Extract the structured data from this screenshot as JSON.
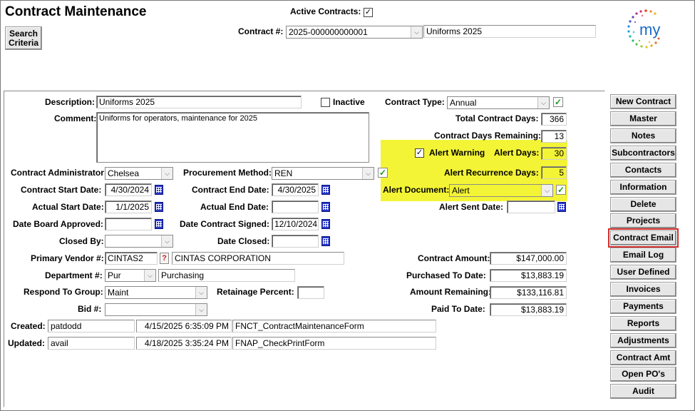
{
  "header": {
    "title": "Contract Maintenance",
    "search_button": "Search Criteria",
    "active_contracts_label": "Active Contracts:",
    "active_contracts_checked": true,
    "contract_no_label": "Contract #:",
    "contract_no_value": "2025-000000000001",
    "contract_name_value": "Uniforms 2025",
    "logo_text": "my"
  },
  "form": {
    "description_label": "Description:",
    "description_value": "Uniforms 2025",
    "inactive_label": "Inactive",
    "inactive_checked": false,
    "comment_label": "Comment:",
    "comment_value": "Uniforms for operators,  maintenance for 2025",
    "contract_type_label": "Contract Type:",
    "contract_type_value": "Annual",
    "total_days_label": "Total Contract Days:",
    "total_days_value": "366",
    "days_remaining_label": "Contract Days Remaining:",
    "days_remaining_value": "13",
    "alert_warning_label": "Alert Warning",
    "alert_warning_checked": true,
    "alert_days_label": "Alert Days:",
    "alert_days_value": "30",
    "alert_recurrence_label": "Alert Recurrence Days:",
    "alert_recurrence_value": "5",
    "alert_document_label": "Alert Document:",
    "alert_document_value": "Alert",
    "alert_sent_label": "Alert Sent Date:",
    "alert_sent_value": "",
    "admin_label": "Contract Administrator:",
    "admin_value": "Chelsea",
    "procurement_label": "Procurement Method:",
    "procurement_value": "REN",
    "start_label": "Contract Start Date:",
    "start_value": "4/30/2024",
    "end_label": "Contract End Date:",
    "end_value": "4/30/2025",
    "actual_start_label": "Actual Start Date:",
    "actual_start_value": "1/1/2025",
    "actual_end_label": "Actual End Date:",
    "actual_end_value": "",
    "board_label": "Date Board Approved:",
    "board_value": "",
    "signed_label": "Date Contract Signed:",
    "signed_value": "12/10/2024",
    "closed_by_label": "Closed By:",
    "closed_by_value": "",
    "date_closed_label": "Date Closed:",
    "date_closed_value": "",
    "vendor_label": "Primary Vendor #:",
    "vendor_code": "CINTAS2",
    "vendor_name": "CINTAS CORPORATION",
    "dept_label": "Department #:",
    "dept_code": "Pur",
    "dept_name": "Purchasing",
    "respond_label": "Respond To Group:",
    "respond_value": "Maint",
    "retainage_label": "Retainage Percent:",
    "retainage_value": "",
    "bid_label": "Bid #:",
    "bid_value": "",
    "amount_label": "Contract Amount:",
    "amount_value": "$147,000.00",
    "purchased_label": "Purchased To Date:",
    "purchased_value": "$13,883.19",
    "remaining_label": "Amount Remaining:",
    "remaining_value": "$133,116.81",
    "paid_label": "Paid To Date:",
    "paid_value": "$13,883.19",
    "created_label": "Created:",
    "created_user": "patdodd",
    "created_time": "4/15/2025 6:35:09 PM",
    "created_form": "FNCT_ContractMaintenanceForm",
    "updated_label": "Updated:",
    "updated_user": "avail",
    "updated_time": "4/18/2025 3:35:24 PM",
    "updated_form": "FNAP_CheckPrintForm"
  },
  "sidebar": {
    "buttons": [
      "New Contract",
      "Master",
      "Notes",
      "Subcontractors",
      "Contacts",
      "Information",
      "Delete",
      "Projects",
      "Contract Email",
      "Email Log",
      "User Defined",
      "Invoices",
      "Payments",
      "Reports",
      "Adjustments",
      "Contract Amt",
      "Open PO's",
      "Audit"
    ],
    "highlighted": "Contract Email"
  },
  "colors": {
    "highlight_yellow": "#f4f436",
    "focus_red": "#d03030",
    "check_green": "#1a9a1a"
  }
}
